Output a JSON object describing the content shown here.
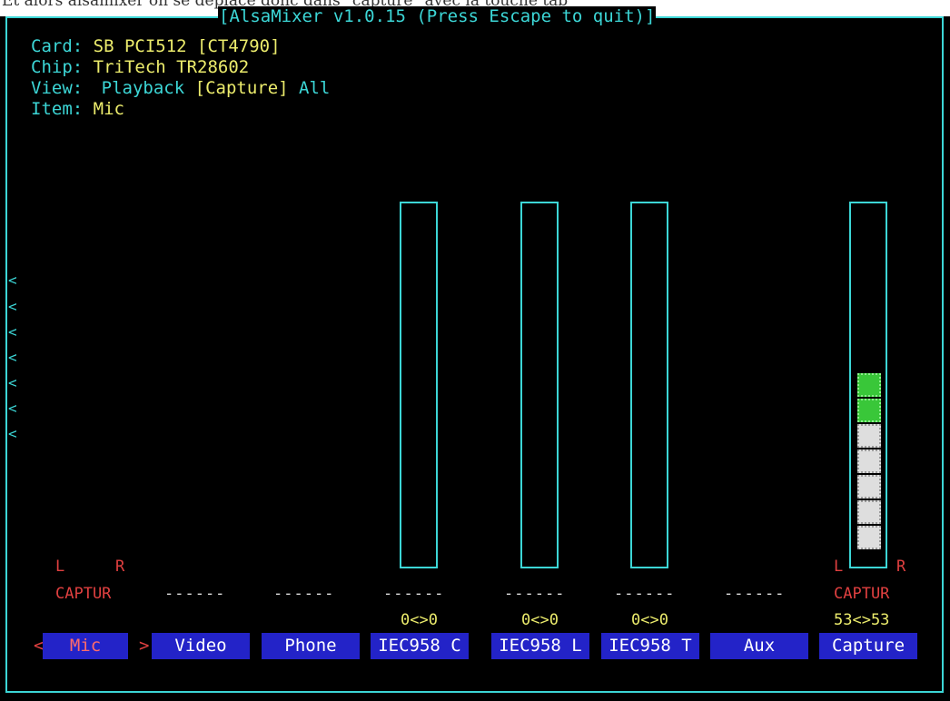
{
  "header_text": "Et alors alsamixer on se deplace donc dans \"capture\" avec la touche tab",
  "window": {
    "title": "[AlsaMixer v1.0.15 (Press Escape to quit)]"
  },
  "info": {
    "card_label": "Card:",
    "card_value": "SB PCI512 [CT4790]",
    "chip_label": "Chip:",
    "chip_value": "TriTech TR28602",
    "view_label": "View:",
    "view_playback": "Playback",
    "view_capture": "[Capture]",
    "view_all": "All",
    "item_label": "Item:",
    "item_value": "Mic"
  },
  "scroll_left_glyph": "<",
  "channels": [
    {
      "name": "Mic",
      "selected": true,
      "lr_left": "L",
      "lr_right": "R",
      "state": "CAPTUR"
    },
    {
      "name": "Video",
      "state": "------"
    },
    {
      "name": "Phone",
      "state": "------"
    },
    {
      "name": "IEC958 C",
      "state": "------",
      "value": "0<>0"
    },
    {
      "name": "IEC958 L",
      "state": "------",
      "value": "0<>0"
    },
    {
      "name": "IEC958 T",
      "state": "------",
      "value": "0<>0"
    },
    {
      "name": "Aux",
      "state": "------"
    },
    {
      "name": "Capture",
      "lr_left": "L",
      "lr_right": "R",
      "state": "CAPTUR",
      "value": "53<>53",
      "level_percent": 53
    }
  ],
  "selection_brackets": {
    "left": "<",
    "right": ">"
  },
  "colors": {
    "border": "#3cd6d6",
    "label": "#3cd6d6",
    "value": "#ecec6c",
    "capture_tag": "#e04040",
    "name_bg": "#2323c8",
    "level_green": "#39c739",
    "level_white": "#dedede"
  }
}
